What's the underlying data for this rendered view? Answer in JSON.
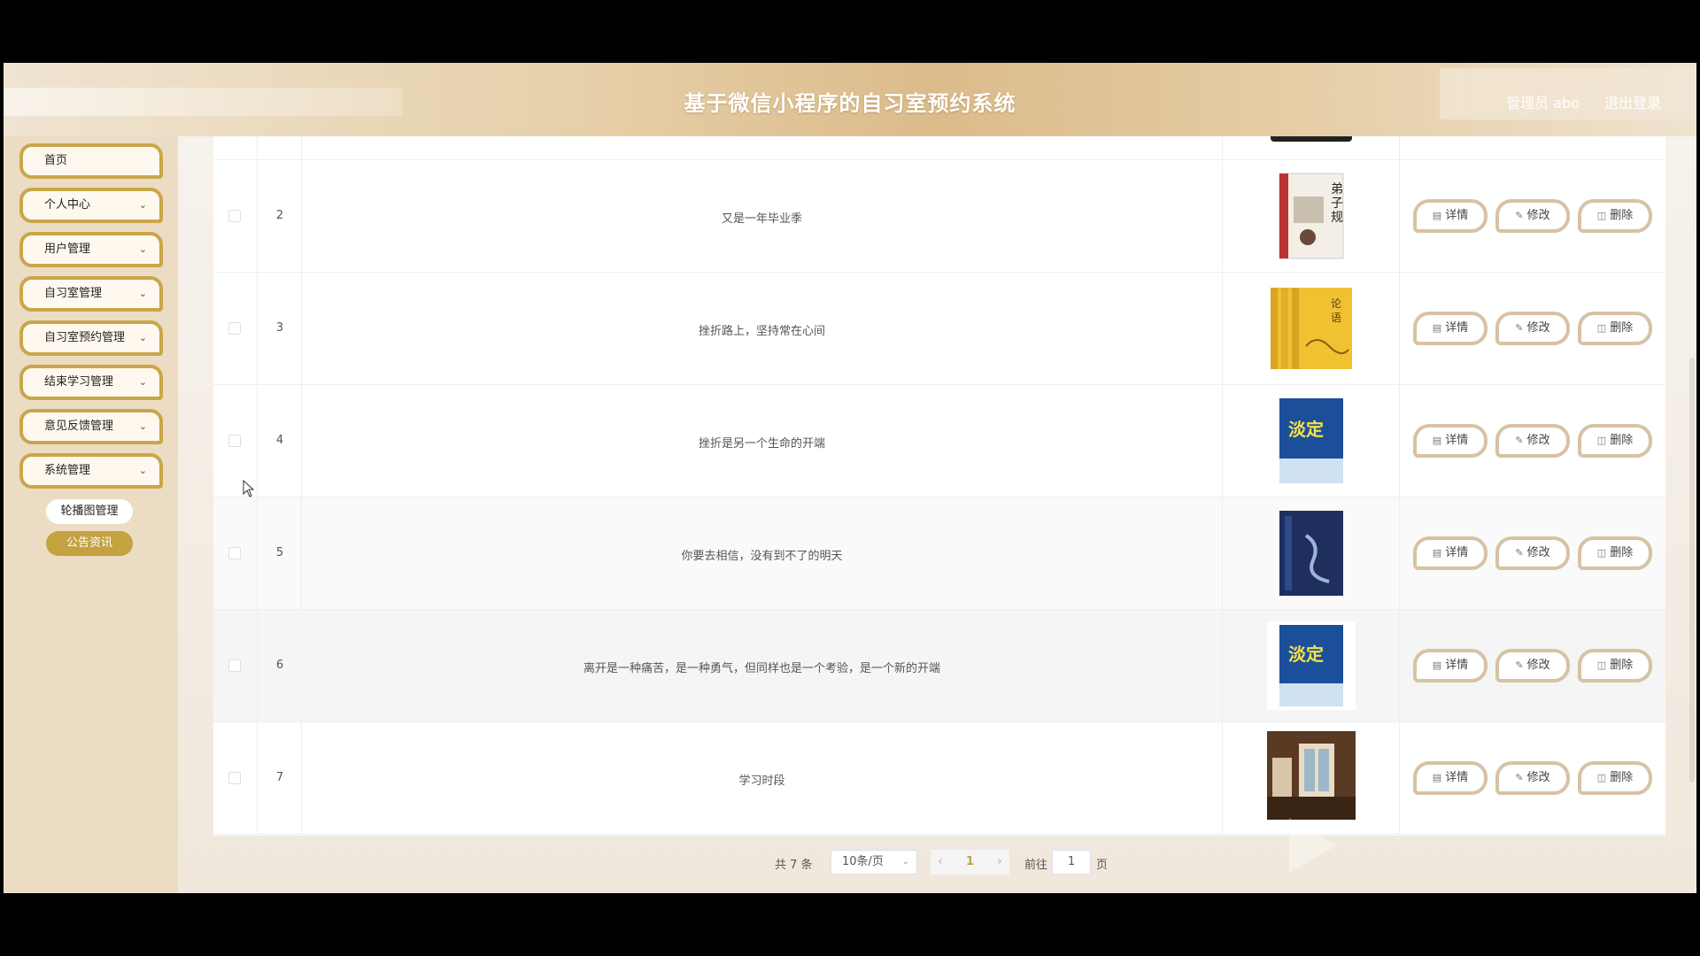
{
  "header": {
    "title": "基于微信小程序的自习室预约系统",
    "user_label": "管理员 abo",
    "logout_label": "退出登录"
  },
  "sidebar": {
    "items": [
      {
        "label": "首页",
        "has_chevron": false
      },
      {
        "label": "个人中心",
        "has_chevron": true
      },
      {
        "label": "用户管理",
        "has_chevron": true
      },
      {
        "label": "自习室管理",
        "has_chevron": true
      },
      {
        "label": "自习室预约管理",
        "has_chevron": true
      },
      {
        "label": "结束学习管理",
        "has_chevron": true
      },
      {
        "label": "意见反馈管理",
        "has_chevron": true
      },
      {
        "label": "系统管理",
        "has_chevron": true
      }
    ],
    "sub_items": [
      {
        "label": "轮播图管理",
        "active": false
      },
      {
        "label": "公告资讯",
        "active": true
      }
    ]
  },
  "table": {
    "rows": [
      {
        "index": "2",
        "title": "又是一年毕业季",
        "cover": "book-dizigui"
      },
      {
        "index": "3",
        "title": "挫折路上，坚持常在心间",
        "cover": "book-lunyu"
      },
      {
        "index": "4",
        "title": "挫折是另一个生命的开端",
        "cover": "book-danding"
      },
      {
        "index": "5",
        "title": "你要去相信，没有到不了的明天",
        "cover": "book-dark-blue"
      },
      {
        "index": "6",
        "title": "离开是一种痛苦，是一种勇气，但同样也是一个考验，是一个新的开端",
        "cover": "book-danding"
      },
      {
        "index": "7",
        "title": "学习时段",
        "cover": "photo-study-room"
      }
    ],
    "actions": {
      "detail": "详情",
      "edit": "修改",
      "delete": "删除"
    }
  },
  "pagination": {
    "total": "共 7 条",
    "page_size": "10条/页",
    "current_page": "1",
    "goto_label": "前往",
    "goto_value": "1",
    "page_suffix": "页"
  },
  "colors": {
    "accent": "#c3a23f",
    "menu_border": "#c9a64b",
    "button_border": "#d7c2a4"
  }
}
